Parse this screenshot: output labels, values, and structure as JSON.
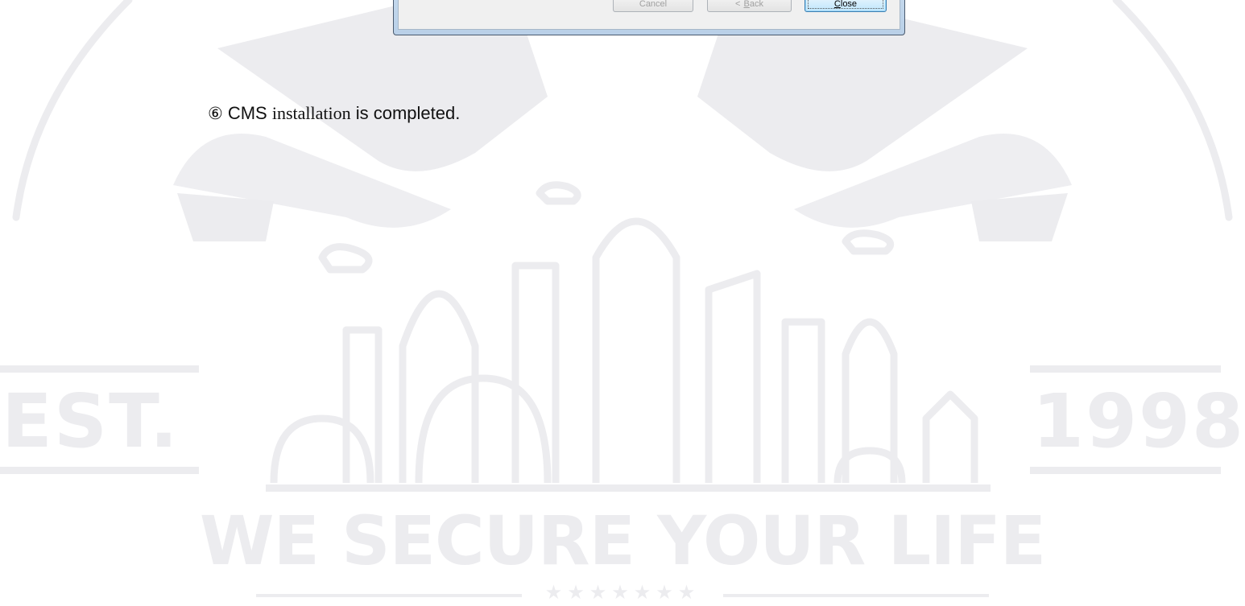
{
  "dialog": {
    "cancel_label": "Cancel",
    "back_mnemonic": "B",
    "back_rest": "ack",
    "back_arrow": "<",
    "close_mnemonic": "C",
    "close_rest": "lose"
  },
  "step": {
    "number": "⑥",
    "part1": "CMS ",
    "part2": "installation",
    "part3": " is completed."
  },
  "watermark": {
    "est": "EST.",
    "year": "1998",
    "slogan": "WE SECURE YOUR LIFE",
    "stars": "★★★★★★★",
    "color": "#ececef"
  }
}
